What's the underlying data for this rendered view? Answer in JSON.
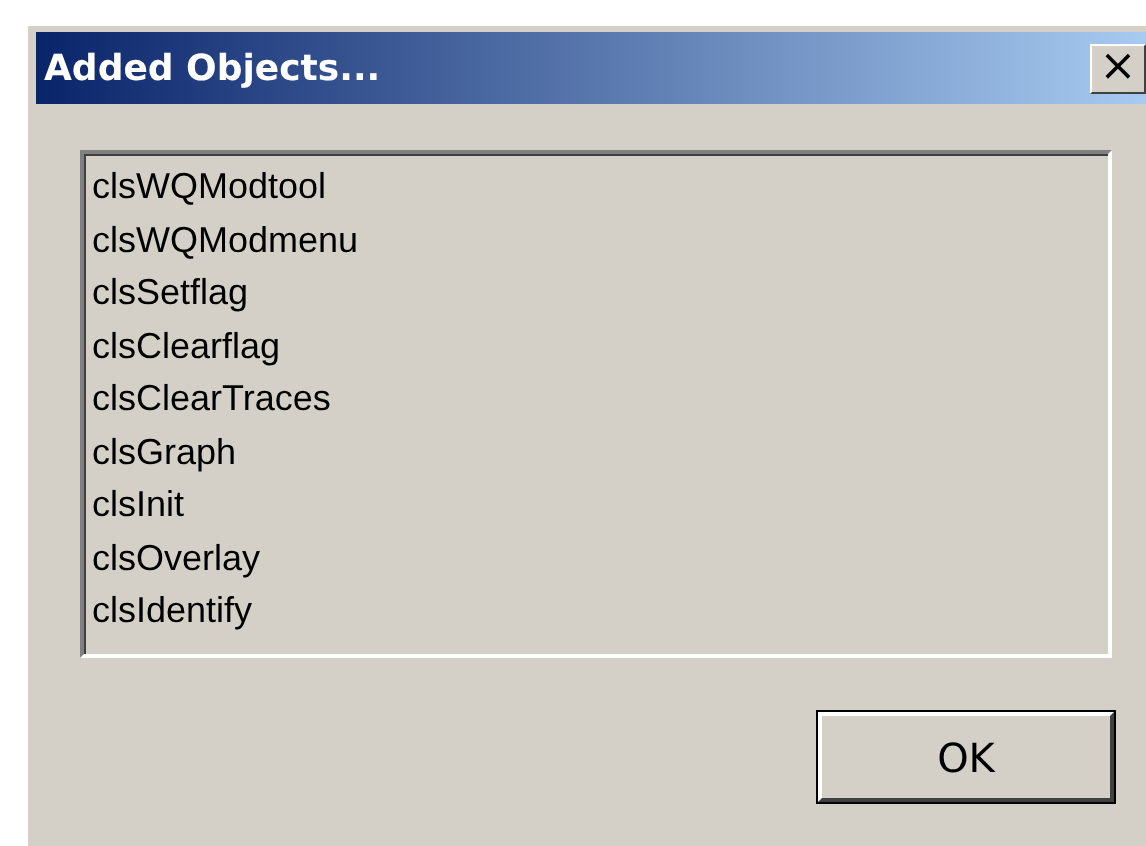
{
  "window": {
    "title": "Added Objects...",
    "close": "×"
  },
  "list": {
    "items": [
      {
        "label": "clsWQModtool"
      },
      {
        "label": "clsWQModmenu"
      },
      {
        "label": "clsSetflag"
      },
      {
        "label": "clsClearflag"
      },
      {
        "label": "clsClearTraces"
      },
      {
        "label": "clsGraph"
      },
      {
        "label": "clsInit"
      },
      {
        "label": "clsOverlay"
      },
      {
        "label": "clsIdentify"
      }
    ]
  },
  "buttons": [
    {
      "label": "OK"
    }
  ]
}
